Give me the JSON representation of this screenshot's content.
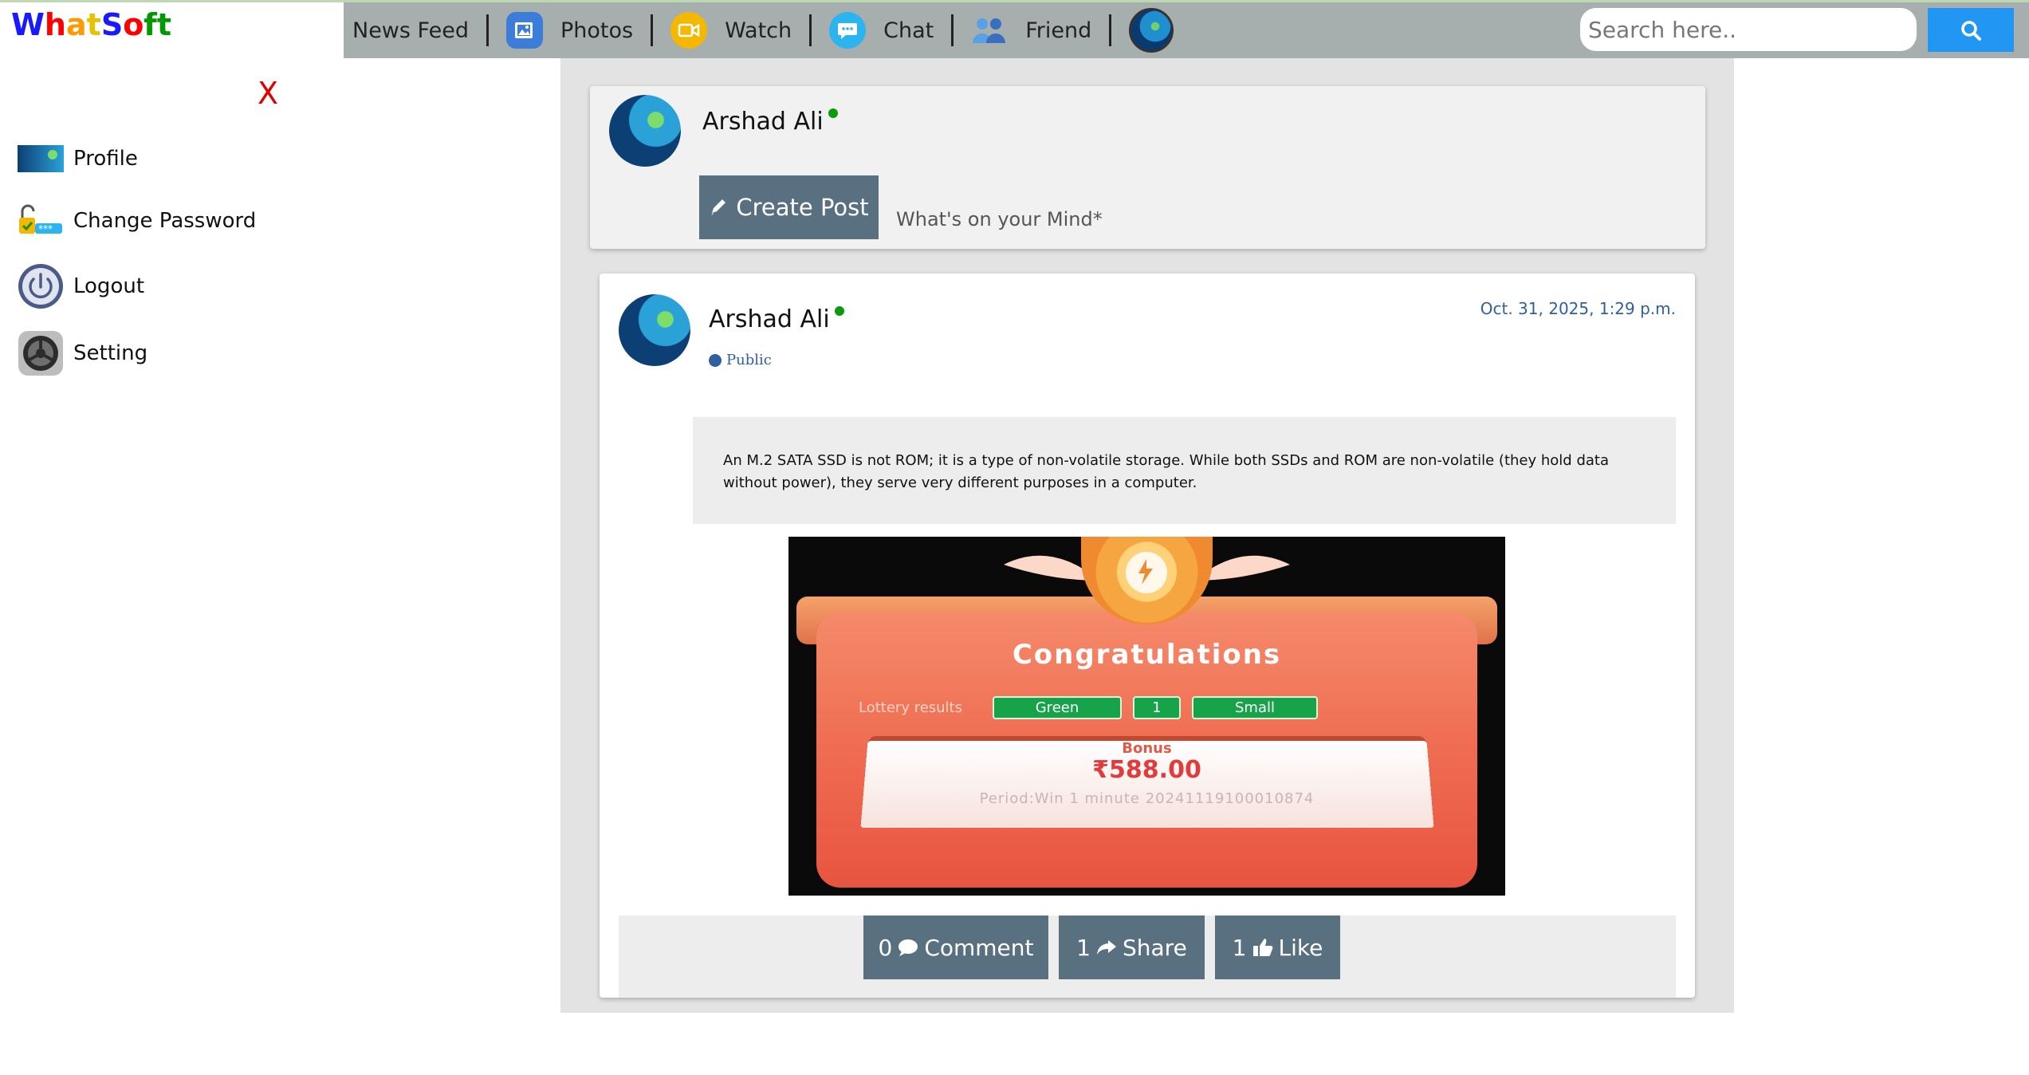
{
  "brand": {
    "letters": [
      "W",
      "h",
      "a",
      "t",
      "S",
      "o",
      "f",
      "t"
    ],
    "colors": [
      "#1a1aff",
      "#ff0000",
      "#ff9900",
      "#e6c200",
      "#1a1aff",
      "#ff0000",
      "#009900",
      "#009900"
    ]
  },
  "nav": {
    "items": [
      {
        "label": "News Feed",
        "icon": ""
      },
      {
        "label": "Photos",
        "icon": "photos-icon"
      },
      {
        "label": "Watch",
        "icon": "video-icon"
      },
      {
        "label": "Chat",
        "icon": "chat-icon"
      },
      {
        "label": "Friend",
        "icon": "friends-icon"
      }
    ]
  },
  "search": {
    "placeholder": "Search here.."
  },
  "sidebar": {
    "close_label": "X",
    "items": [
      {
        "label": "Profile",
        "icon": "profile-thumbnail"
      },
      {
        "label": "Change Password",
        "icon": "lock-icon"
      },
      {
        "label": "Logout",
        "icon": "power-icon"
      },
      {
        "label": "Setting",
        "icon": "gear-icon"
      }
    ]
  },
  "create_post": {
    "user_name": "Arshad Ali",
    "button_label": "Create Post",
    "prompt": "What's on your Mind*"
  },
  "post": {
    "user_name": "Arshad Ali",
    "visibility": "Public",
    "date": "Oct. 31, 2025, 1:29 p.m.",
    "text": "An M.2 SATA SSD is not ROM; it is a type of non-volatile storage. While both SSDs and ROM are non-volatile (they hold data without power), they serve very different purposes in a computer.",
    "image": {
      "title": "Congratulations",
      "lottery_label": "Lottery results",
      "pills": [
        "Green",
        "1",
        "Small"
      ],
      "bonus_label": "Bonus",
      "amount": "₹588.00",
      "period": "Period:Win 1 minute 20241119100010874"
    },
    "actions": {
      "comment_count": "0",
      "comment_label": "Comment",
      "share_count": "1",
      "share_label": "Share",
      "like_count": "1",
      "like_label": "Like"
    }
  },
  "colors": {
    "topbar": "#a6aeae",
    "accent": "#2196f3",
    "button": "#587080",
    "main_bg": "#e3e3e3",
    "close": "#e00000",
    "online": "#0a9a0a",
    "link": "#2f5f9e"
  }
}
